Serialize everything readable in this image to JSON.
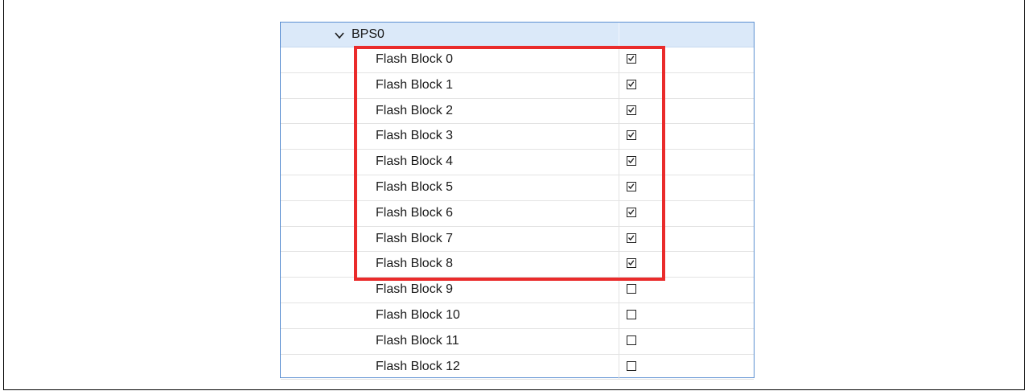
{
  "tree": {
    "group": {
      "label": "BPS0",
      "expanded": true
    },
    "items": [
      {
        "label": "Flash Block 0",
        "checked": true
      },
      {
        "label": "Flash Block 1",
        "checked": true
      },
      {
        "label": "Flash Block 2",
        "checked": true
      },
      {
        "label": "Flash Block 3",
        "checked": true
      },
      {
        "label": "Flash Block 4",
        "checked": true
      },
      {
        "label": "Flash Block 5",
        "checked": true
      },
      {
        "label": "Flash Block 6",
        "checked": true
      },
      {
        "label": "Flash Block 7",
        "checked": true
      },
      {
        "label": "Flash Block 8",
        "checked": true
      },
      {
        "label": "Flash Block 9",
        "checked": false
      },
      {
        "label": "Flash Block 10",
        "checked": false
      },
      {
        "label": "Flash Block 11",
        "checked": false
      },
      {
        "label": "Flash Block 12",
        "checked": false
      }
    ]
  },
  "colors": {
    "highlight": "#ea2b2b",
    "header_bg": "#dbe9f9",
    "panel_border": "#5b8fd1"
  }
}
